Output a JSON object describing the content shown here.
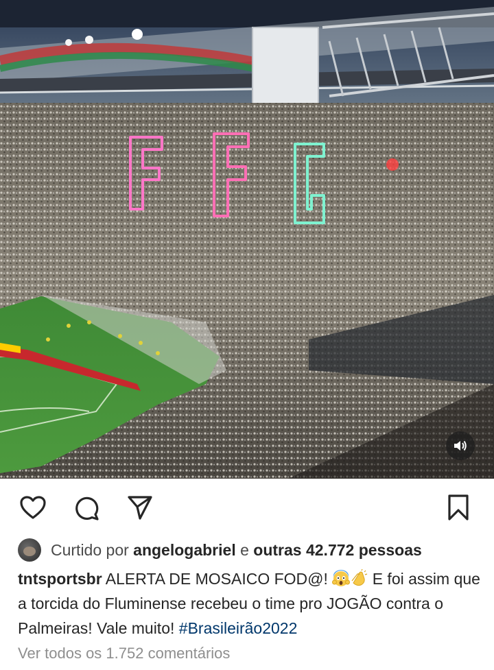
{
  "post": {
    "liked_by_prefix": "Curtido por",
    "liked_by_user": "angelogabriel",
    "liked_by_and": "e",
    "liked_by_others": "outras 42.772 pessoas",
    "caption_user": "tntsportsbr",
    "caption_part1": "ALERTA DE MOSAICO FOD@!",
    "caption_emojis": [
      "face-screaming-emoji",
      "clapping-hands-emoji"
    ],
    "caption_part2": "E foi assim que a torcida do Fluminense recebeu o time pro JOGÃO contra o Palmeiras! Vale muito!",
    "caption_hashtag": "#Brasileirão2022",
    "view_comments": "Ver todos os 1.752 comentários"
  },
  "media": {
    "type": "video",
    "scene_text": [
      "F",
      "F",
      "C"
    ],
    "sound_icon": "speaker-icon"
  },
  "icons": [
    "heart-icon",
    "comment-icon",
    "share-icon",
    "bookmark-icon"
  ],
  "colors": {
    "hashtag": "#00376b",
    "text": "#262626",
    "muted": "#8e8e8e"
  }
}
